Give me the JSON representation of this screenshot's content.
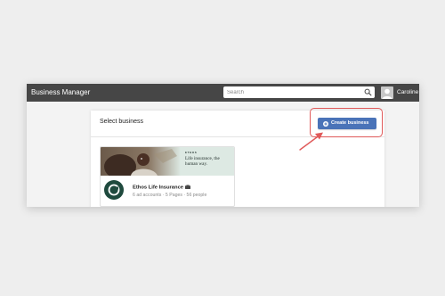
{
  "topbar": {
    "app_title": "Business Manager",
    "search_placeholder": "Search",
    "user_name": "Caroline",
    "icons": {
      "search": "search-icon",
      "avatar": "person-avatar"
    }
  },
  "panel": {
    "title": "Select business",
    "create_button_label": "Create business",
    "create_button_icon": "plus-circle-icon"
  },
  "business_card": {
    "cover_brand": "ETHOS",
    "cover_tagline": "Life insurance, the human way.",
    "name": "Ethos Life Insurance",
    "badge_icon": "briefcase-icon",
    "meta": "6 ad accounts · 5 Pages · 56 people"
  },
  "colors": {
    "topbar": "#464646",
    "button": "#4a73b8",
    "highlight": "#e05a5a",
    "logo": "#1f4a3e",
    "cover": "#dde9e3"
  }
}
